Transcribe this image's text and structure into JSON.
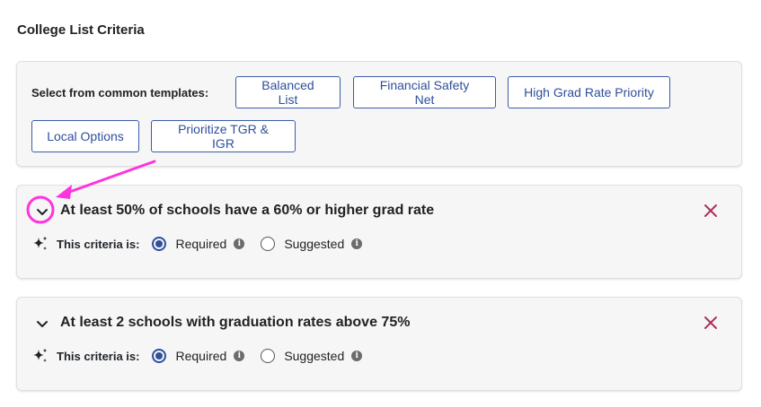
{
  "page": {
    "title": "College List Criteria"
  },
  "templates": {
    "label": "Select from common templates:",
    "buttons": [
      {
        "label": "Balanced List"
      },
      {
        "label": "Financial Safety Net"
      },
      {
        "label": "High Grad Rate Priority"
      },
      {
        "label": "Local Options"
      },
      {
        "label": "Prioritize TGR & IGR"
      }
    ]
  },
  "criteria": [
    {
      "title": "At least 50% of schools have a 60% or higher grad rate",
      "criteria_label": "This criteria is:",
      "options": [
        {
          "label": "Required",
          "checked": true
        },
        {
          "label": "Suggested",
          "checked": false
        }
      ]
    },
    {
      "title": "At least 2 schools with graduation rates above 75%",
      "criteria_label": "This criteria is:",
      "options": [
        {
          "label": "Required",
          "checked": true
        },
        {
          "label": "Suggested",
          "checked": false
        }
      ]
    }
  ],
  "icons": {
    "chevron": "chevron-down-icon",
    "close": "close-icon",
    "sparkle": "sparkle-icon",
    "info": "info-icon"
  },
  "colors": {
    "accent": "#2f4f9a",
    "close": "#b0305a",
    "annotation": "#ff33dd",
    "card_bg": "#f6f6f7"
  }
}
